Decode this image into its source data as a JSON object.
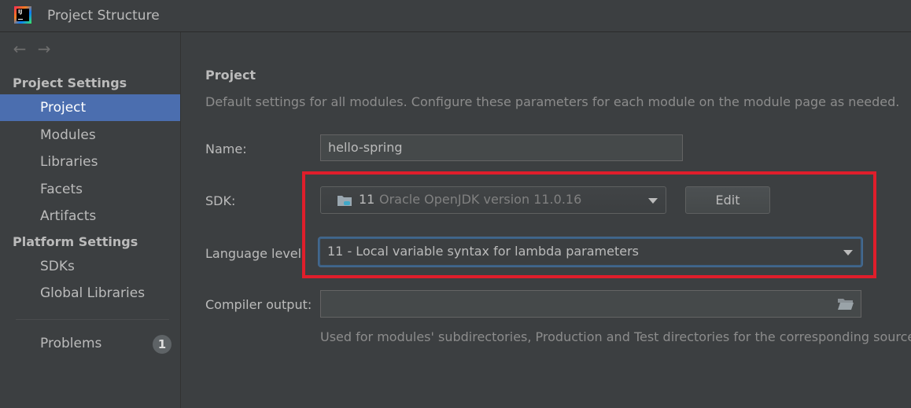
{
  "window": {
    "title": "Project Structure",
    "logo_text": "IJ"
  },
  "sidebar": {
    "nav": {
      "back": "←",
      "forward": "→"
    },
    "project_settings_header": "Project Settings",
    "project_items": [
      {
        "label": "Project",
        "selected": true
      },
      {
        "label": "Modules"
      },
      {
        "label": "Libraries"
      },
      {
        "label": "Facets"
      },
      {
        "label": "Artifacts"
      }
    ],
    "platform_settings_header": "Platform Settings",
    "platform_items": [
      {
        "label": "SDKs"
      },
      {
        "label": "Global Libraries"
      }
    ],
    "problems": {
      "label": "Problems",
      "count": "1"
    }
  },
  "main": {
    "title": "Project",
    "description": "Default settings for all modules. Configure these parameters for each module on the module page as needed.",
    "name_label": "Name:",
    "name_value": "hello-spring",
    "sdk_label": "SDK:",
    "sdk_version": "11",
    "sdk_name": "Oracle OpenJDK version 11.0.16",
    "edit_label": "Edit",
    "language_level_label": "Language level:",
    "language_level_value": "11 - Local variable syntax for lambda parameters",
    "compiler_output_label": "Compiler output:",
    "compiler_output_value": "",
    "compiler_hint": "Used for modules' subdirectories, Production and Test directories for the corresponding sources."
  },
  "colors": {
    "background": "#3c3f41",
    "selection": "#4b6eaf",
    "highlight": "#e01e2b",
    "focus": "#3d6185"
  }
}
